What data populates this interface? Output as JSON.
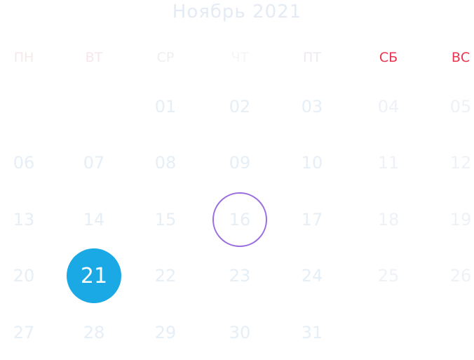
{
  "calendar": {
    "month_title": "Ноябрь 2021",
    "weekend_color": "#e8344e",
    "today_ring_color": "#9b6ee0",
    "selected_color": "#1aa9e4",
    "weekdays": [
      "ПН",
      "ВТ",
      "СР",
      "ЧТ",
      "ПТ",
      "СБ",
      "ВС"
    ],
    "weeks": [
      [
        "",
        "",
        "01",
        "02",
        "03",
        "04",
        "05"
      ],
      [
        "06",
        "07",
        "08",
        "09",
        "10",
        "11",
        "12"
      ],
      [
        "13",
        "14",
        "15",
        "16",
        "17",
        "18",
        "19"
      ],
      [
        "20",
        "21",
        "22",
        "23",
        "24",
        "25",
        "26"
      ],
      [
        "27",
        "28",
        "29",
        "30",
        "31",
        "",
        ""
      ]
    ],
    "today": "16",
    "selected": "21"
  }
}
